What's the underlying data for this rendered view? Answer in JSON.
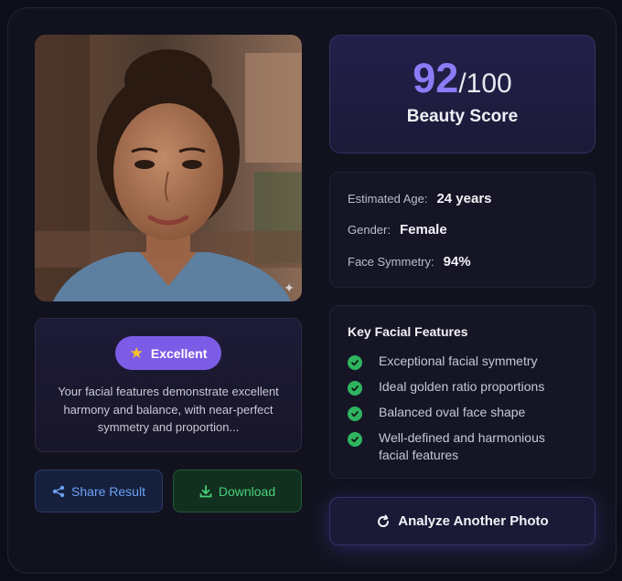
{
  "photo": {
    "alt": "portrait photo",
    "sparkle_icon": "sparkle-icon"
  },
  "rating": {
    "badge_label": "Excellent",
    "badge_icon": "star-icon",
    "description": "Your facial features demonstrate excellent harmony and balance, with near-perfect symmetry and proportion..."
  },
  "actions": {
    "share_label": "Share Result",
    "share_icon": "share-icon",
    "download_label": "Download",
    "download_icon": "download-icon",
    "analyze_label": "Analyze Another Photo",
    "analyze_icon": "refresh-icon"
  },
  "score": {
    "value": "92",
    "max": "/100",
    "label": "Beauty Score"
  },
  "stats": [
    {
      "label": "Estimated Age:",
      "value": "24 years"
    },
    {
      "label": "Gender:",
      "value": "Female"
    },
    {
      "label": "Face Symmetry:",
      "value": "94%"
    }
  ],
  "features": {
    "title": "Key Facial Features",
    "items": [
      {
        "text": "Exceptional facial symmetry"
      },
      {
        "text": "Ideal golden ratio proportions"
      },
      {
        "text": "Balanced oval face shape"
      },
      {
        "text": "Well-defined and harmonious facial features"
      }
    ]
  },
  "colors": {
    "accent": "#8b7cf6",
    "badge": "#7c5ce6",
    "share": "#6aa1f2",
    "download": "#46d079",
    "check": "#2fb460"
  }
}
